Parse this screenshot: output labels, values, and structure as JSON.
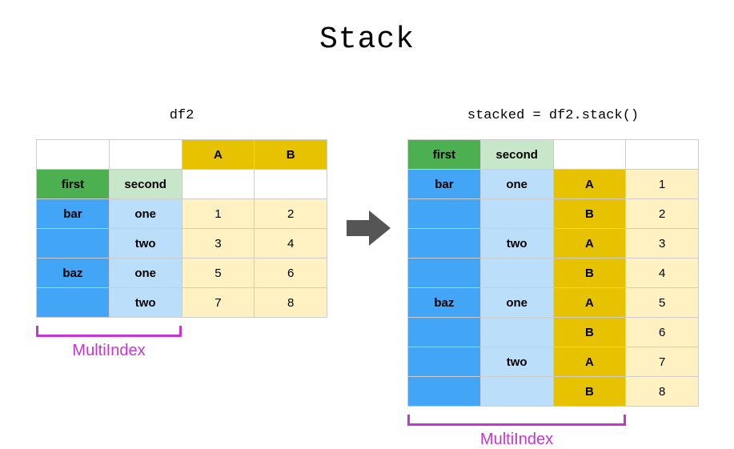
{
  "title": "Stack",
  "left": {
    "caption": "df2",
    "index_names": {
      "first": "first",
      "second": "second"
    },
    "col_labels": {
      "A": "A",
      "B": "B"
    },
    "idx_first": {
      "r0": "bar",
      "r1": "",
      "r2": "baz",
      "r3": ""
    },
    "idx_second": {
      "r0": "one",
      "r1": "two",
      "r2": "one",
      "r3": "two"
    },
    "vals": {
      "r0": {
        "A": "1",
        "B": "2"
      },
      "r1": {
        "A": "3",
        "B": "4"
      },
      "r2": {
        "A": "5",
        "B": "6"
      },
      "r3": {
        "A": "7",
        "B": "8"
      }
    },
    "multiindex_label": "MultiIndex"
  },
  "right": {
    "caption": "stacked = df2.stack()",
    "index_names": {
      "first": "first",
      "second": "second"
    },
    "idx_first": {
      "r0": "bar",
      "r1": "",
      "r2": "",
      "r3": "",
      "r4": "baz",
      "r5": "",
      "r6": "",
      "r7": ""
    },
    "idx_second": {
      "r0": "one",
      "r1": "",
      "r2": "two",
      "r3": "",
      "r4": "one",
      "r5": "",
      "r6": "two",
      "r7": ""
    },
    "idx_third": {
      "r0": "A",
      "r1": "B",
      "r2": "A",
      "r3": "B",
      "r4": "A",
      "r5": "B",
      "r6": "A",
      "r7": "B"
    },
    "vals": {
      "r0": "1",
      "r1": "2",
      "r2": "3",
      "r3": "4",
      "r4": "5",
      "r5": "6",
      "r6": "7",
      "r7": "8"
    },
    "multiindex_label": "MultiIndex"
  }
}
